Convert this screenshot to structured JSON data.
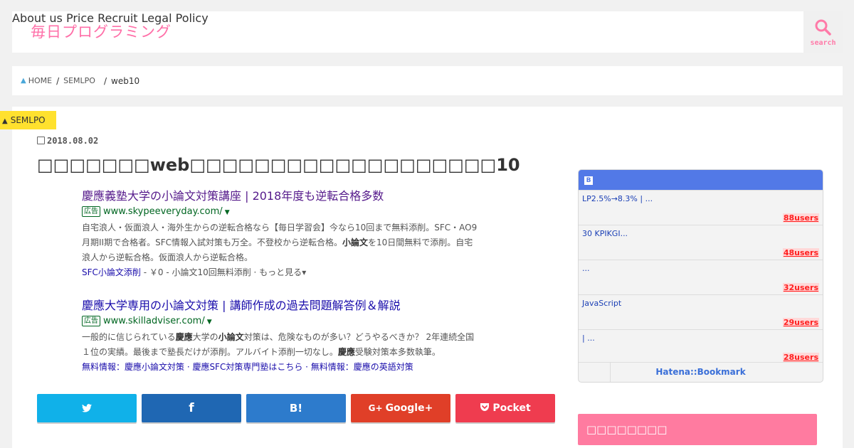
{
  "header": {
    "logo": "毎日プログラミング",
    "nav": [
      {
        "label": "About us"
      },
      {
        "label": "Price"
      },
      {
        "label": "Recruit"
      },
      {
        "label": "Legal Policy"
      }
    ],
    "search_label": "search"
  },
  "breadcrumb": {
    "home": "HOME",
    "category": "SEMLPO",
    "current": "web10",
    "sep": "/"
  },
  "article": {
    "category_badge": "SEMLPO",
    "date": "2018.08.02",
    "title": "□□□□□□□web□□□□□□□□□□□□□□□□□□□10"
  },
  "ads": [
    {
      "title": "慶應義塾大学の小論文対策講座 | 2018年度も逆転合格多数",
      "tag": "広告",
      "url": "www.skypeeveryday.com/",
      "desc_lines": [
        "自宅浪人・仮面浪人・海外生からの逆転合格なら【毎日学習会】今なら10回まで無料添削。SFC・AO9",
        "月期II期で合格者。SFC情報入試対策も万全。不登校から逆転合格。",
        "浪人から逆転合格。仮面浪人から逆転合格。"
      ],
      "desc_bold": "小論文",
      "desc_line2_tail": "を10日間無料で添削。自宅",
      "links": {
        "main": "SFC小論文添削",
        "rest": " - ￥0 - 小論文10回無料添削 · もっと見る",
        "tri": "▾"
      }
    },
    {
      "title": "慶應大学専用の小論文対策 | 講師作成の過去問題解答例＆解説",
      "tag": "広告",
      "url": "www.skilladviser.com/",
      "desc_lines": [
        "一般的に信じられている",
        "慶應",
        "大学の",
        "小論文",
        "対策は、危険なものが多い？どうやるべきか？ 2年連続全国",
        "１位の実績。最後まで塾長だけが添削。アルバイト添削一切なし。",
        "慶應",
        "受験対策本多数執筆。"
      ],
      "links_text": "無料情報：慶應小論文対策 · 慶應SFC対策専門塾はこちら · 無料情報：慶應の英語対策"
    }
  ],
  "share": {
    "twitter": "",
    "facebook": "f",
    "hatena": "B!",
    "google": "Google+",
    "pocket": "Pocket",
    "colors": {
      "twitter": "#10b1e9",
      "facebook": "#1f67b3",
      "hatena": "#2d7bcc",
      "google": "#e03f28",
      "pocket": "#ef3c4f"
    }
  },
  "hatena_widget": {
    "rows": [
      {
        "title": "LP2.5%→8.3% | ...",
        "users": "88users"
      },
      {
        "title": "30 KPIKGI...",
        "users": "48users"
      },
      {
        "title": "...",
        "users": "32users"
      },
      {
        "title": "JavaScript",
        "users": "29users"
      },
      {
        "title": "| ...",
        "users": "28users"
      }
    ],
    "footer": "Hatena::Bookmark"
  },
  "sidebar": {
    "widget_title": "□□□□□□□□"
  },
  "colors": {
    "accent": "#ff7aa8",
    "badge": "#ffe12e",
    "hatena_blue": "#5279e7"
  }
}
